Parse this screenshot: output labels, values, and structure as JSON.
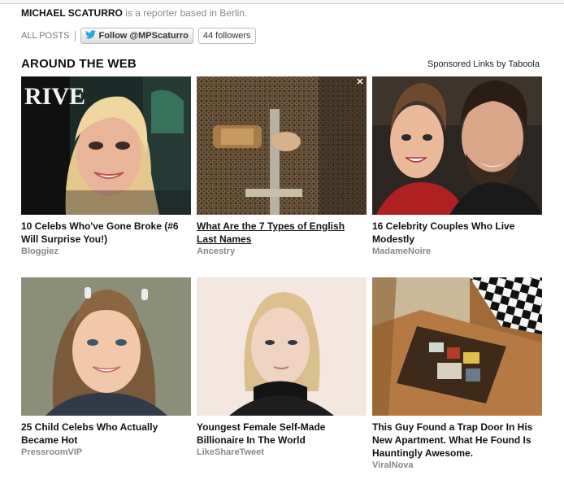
{
  "author": {
    "name": "MICHAEL SCATURRO",
    "bio": " is a reporter based in Berlin."
  },
  "meta": {
    "all_posts": "ALL POSTS",
    "follow_label": "Follow @MPScaturro",
    "followers": "44 followers"
  },
  "section": {
    "title": "AROUND THE WEB",
    "sponsored": "Sponsored Links by Taboola"
  },
  "cards": [
    {
      "headline": "10 Celebs Who've Gone Broke (#6 Will Surprise You!)",
      "source": "Bloggiez",
      "image_text": "RIVE"
    },
    {
      "headline": "What Are the 7 Types of English Last Names",
      "source": "Ancestry"
    },
    {
      "headline": "16 Celebrity Couples Who Live Modestly",
      "source": "MadameNoire"
    },
    {
      "headline": "25 Child Celebs Who Actually Became Hot",
      "source": "PressroomVIP"
    },
    {
      "headline": "Youngest Female Self-Made Billionaire In The World",
      "source": "LikeShareTweet"
    },
    {
      "headline": "This Guy Found a Trap Door In His New Apartment. What He Found Is Hauntingly Awesome.",
      "source": "ViralNova"
    }
  ],
  "close_glyph": "✕"
}
